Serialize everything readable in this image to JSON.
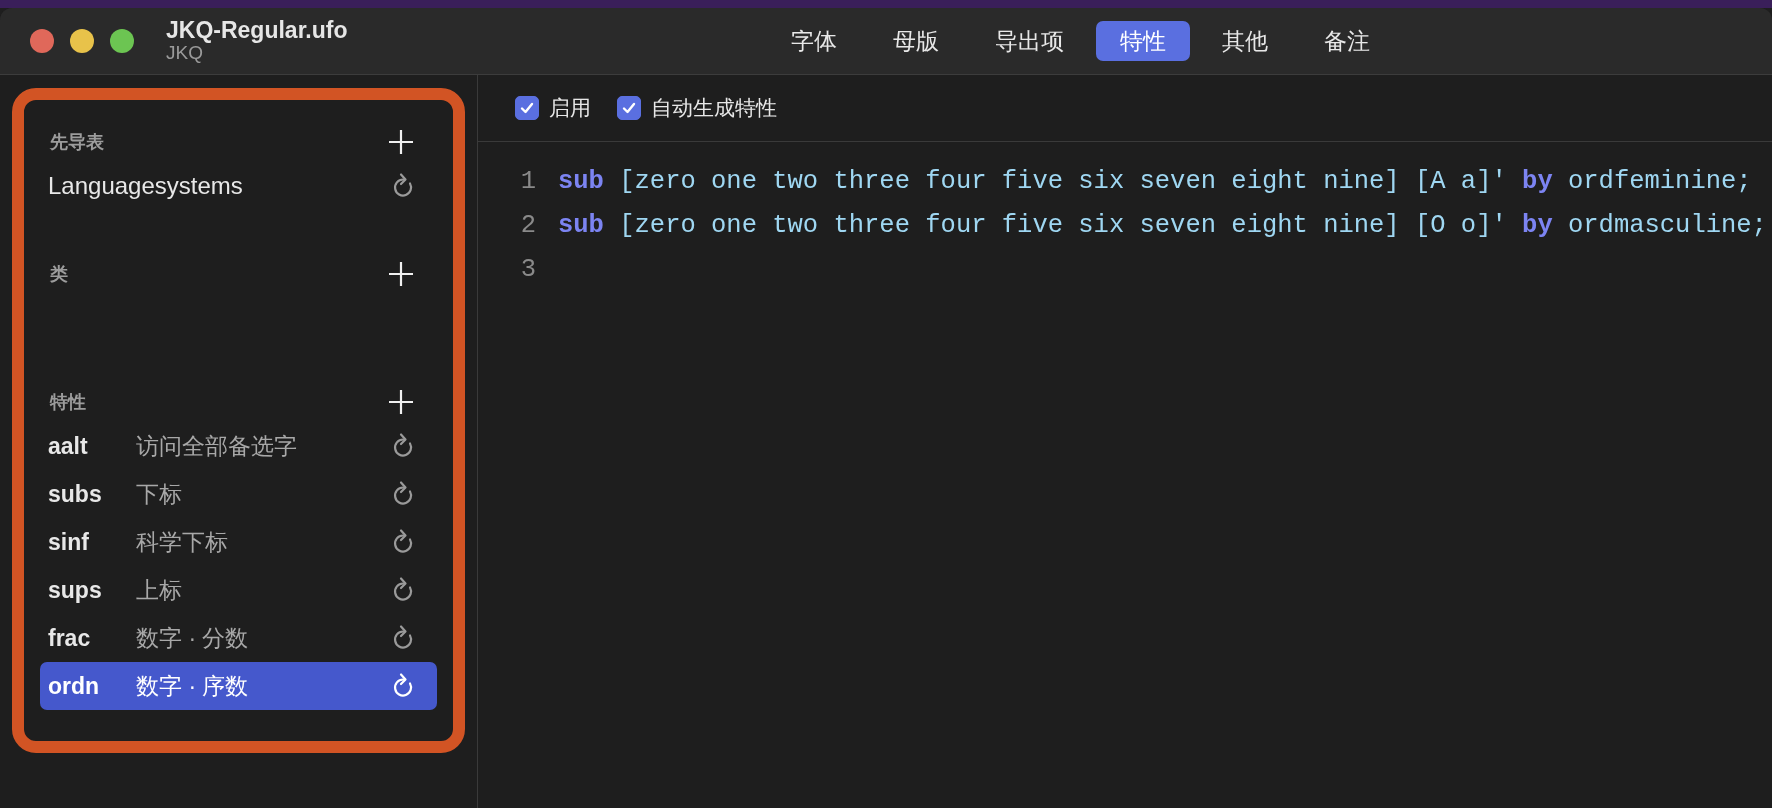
{
  "window": {
    "title": "JKQ-Regular.ufo",
    "subtitle": "JKQ"
  },
  "tabs": [
    {
      "label": "字体",
      "selected": false
    },
    {
      "label": "母版",
      "selected": false
    },
    {
      "label": "导出项",
      "selected": false
    },
    {
      "label": "特性",
      "selected": true
    },
    {
      "label": "其他",
      "selected": false
    },
    {
      "label": "备注",
      "selected": false
    }
  ],
  "sidebar": {
    "sections": [
      {
        "title": "先导表",
        "items": [
          {
            "tag": "Languagesystems",
            "selected": false
          }
        ]
      },
      {
        "title": "类"
      },
      {
        "title": "特性",
        "items": [
          {
            "tag": "aalt",
            "description": "访问全部备选字",
            "selected": false
          },
          {
            "tag": "subs",
            "description": "下标",
            "selected": false
          },
          {
            "tag": "sinf",
            "description": "科学下标",
            "selected": false
          },
          {
            "tag": "sups",
            "description": "上标",
            "selected": false
          },
          {
            "tag": "frac",
            "description": "数字 · 分数",
            "selected": false
          },
          {
            "tag": "ordn",
            "description": "数字 · 序数",
            "selected": true
          }
        ]
      }
    ]
  },
  "options": [
    {
      "label": "启用",
      "checked": true
    },
    {
      "label": "自动生成特性",
      "checked": true
    }
  ],
  "editor": {
    "lines": [
      {
        "number": "1",
        "tokens": [
          {
            "kind": "keyword",
            "text": "sub"
          },
          {
            "kind": "text",
            "text": " [zero one two three four five six seven eight nine] [A a]' "
          },
          {
            "kind": "keyword",
            "text": "by"
          },
          {
            "kind": "text",
            "text": " ordfeminine;"
          }
        ]
      },
      {
        "number": "2",
        "tokens": [
          {
            "kind": "keyword",
            "text": "sub"
          },
          {
            "kind": "text",
            "text": " [zero one two three four five six seven eight nine] [O o]' "
          },
          {
            "kind": "keyword",
            "text": "by"
          },
          {
            "kind": "text",
            "text": " ordmasculine;"
          }
        ]
      },
      {
        "number": "3"
      }
    ]
  }
}
